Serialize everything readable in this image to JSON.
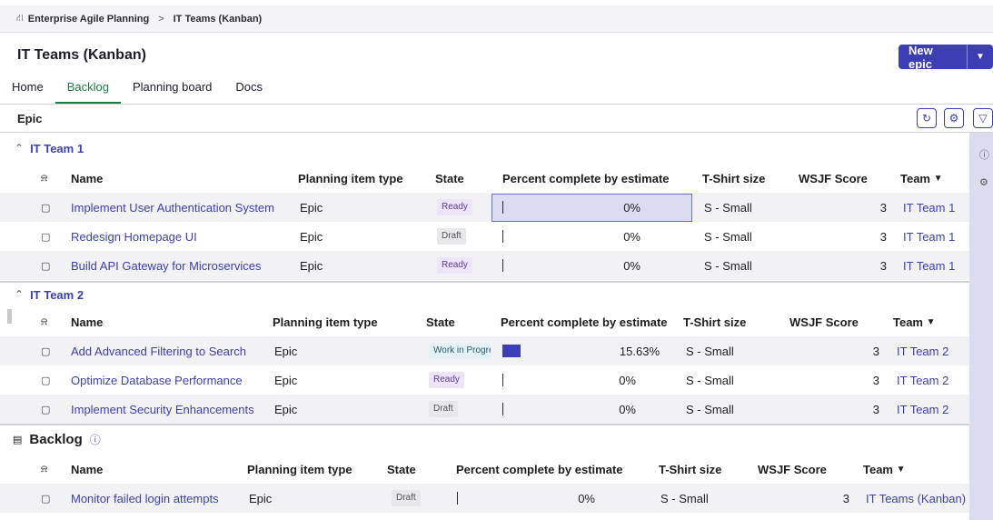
{
  "breadcrumb": {
    "root": "Enterprise Agile Planning",
    "separator": ">",
    "current": "IT Teams (Kanban)"
  },
  "page": {
    "title": "IT Teams (Kanban)",
    "new_button": "New epic"
  },
  "tabs": [
    {
      "label": "Home"
    },
    {
      "label": "Backlog",
      "active": true
    },
    {
      "label": "Planning board"
    },
    {
      "label": "Docs"
    }
  ],
  "epic_bar": {
    "label": "Epic"
  },
  "columns": {
    "name": "Name",
    "planning_item_type": "Planning item type",
    "state": "State",
    "percent": "Percent complete by estimate",
    "tshirt": "T-Shirt size",
    "wsjf": "WSJF Score",
    "team": "Team"
  },
  "groups": [
    {
      "title": "IT Team 1",
      "rows": [
        {
          "name": "Implement User Authentication System",
          "type": "Epic",
          "state": "Ready",
          "percent": "0%",
          "progress": 0,
          "tshirt": "S - Small",
          "wsjf": "3",
          "team": "IT Team 1"
        },
        {
          "name": "Redesign Homepage UI",
          "type": "Epic",
          "state": "Draft",
          "percent": "0%",
          "progress": 0,
          "tshirt": "S - Small",
          "wsjf": "3",
          "team": "IT Team 1"
        },
        {
          "name": "Build API Gateway for Microservices",
          "type": "Epic",
          "state": "Ready",
          "percent": "0%",
          "progress": 0,
          "tshirt": "S - Small",
          "wsjf": "3",
          "team": "IT Team 1"
        }
      ]
    },
    {
      "title": "IT Team 2",
      "rows": [
        {
          "name": "Add Advanced Filtering to Search",
          "type": "Epic",
          "state": "Work in Progress",
          "percent": "15.63%",
          "progress": 0.1563,
          "tshirt": "S - Small",
          "wsjf": "3",
          "team": "IT Team 2"
        },
        {
          "name": "Optimize Database Performance",
          "type": "Epic",
          "state": "Ready",
          "percent": "0%",
          "progress": 0,
          "tshirt": "S - Small",
          "wsjf": "3",
          "team": "IT Team 2"
        },
        {
          "name": "Implement Security Enhancements",
          "type": "Epic",
          "state": "Draft",
          "percent": "0%",
          "progress": 0,
          "tshirt": "S - Small",
          "wsjf": "3",
          "team": "IT Team 2"
        }
      ]
    }
  ],
  "backlog": {
    "title": "Backlog",
    "rows": [
      {
        "name": "Monitor failed login attempts",
        "type": "Epic",
        "state": "Draft",
        "percent": "0%",
        "progress": 0,
        "tshirt": "S - Small",
        "wsjf": "3",
        "team": "IT Teams (Kanban)"
      }
    ]
  },
  "icons": {
    "breadcrumb": "hierarchy-icon",
    "collapse": "chevron-up-icon",
    "refresh": "refresh-icon",
    "settings": "column-settings-icon",
    "filter": "filter-icon",
    "info": "info-icon",
    "gear": "gear-icon",
    "row": "epic-item-icon"
  },
  "colors": {
    "accent": "#3c3fb3",
    "active_tab": "#1b7d46",
    "rail": "#dcdcf1"
  }
}
